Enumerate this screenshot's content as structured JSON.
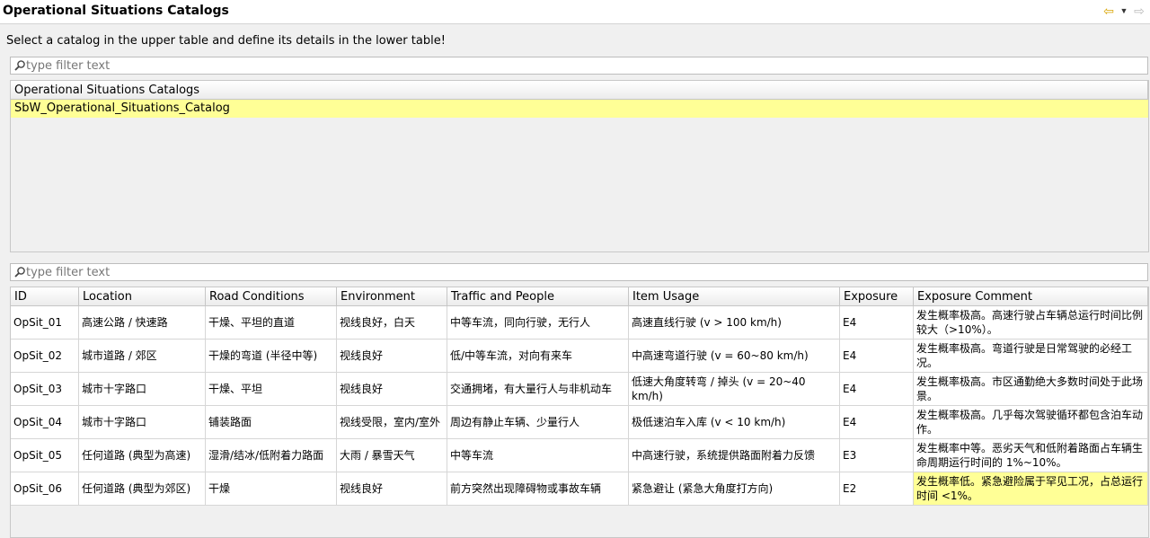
{
  "header": {
    "title": "Operational Situations Catalogs"
  },
  "instruction": "Select a catalog in the upper table and define its details in the lower table!",
  "filter_upper": {
    "placeholder": "type filter text",
    "value": ""
  },
  "filter_lower": {
    "placeholder": "type filter text",
    "value": ""
  },
  "catalog_table": {
    "header": "Operational Situations Catalogs",
    "rows": [
      "SbW_Operational_Situations_Catalog"
    ]
  },
  "detail_table": {
    "columns": [
      "ID",
      "Location",
      "Road Conditions",
      "Environment",
      "Traffic and People",
      "Item Usage",
      "Exposure",
      "Exposure Comment"
    ],
    "rows": [
      [
        "OpSit_01",
        "高速公路 / 快速路",
        "干燥、平坦的直道",
        "视线良好，白天",
        "中等车流，同向行驶，无行人",
        "高速直线行驶 (v > 100 km/h)",
        "E4",
        "发生概率极高。高速行驶占车辆总运行时间比例较大（>10%）。"
      ],
      [
        "OpSit_02",
        "城市道路 / 郊区",
        "干燥的弯道 (半径中等)",
        "视线良好",
        "低/中等车流，对向有来车",
        "中高速弯道行驶 (v = 60~80 km/h)",
        "E4",
        "发生概率极高。弯道行驶是日常驾驶的必经工况。"
      ],
      [
        "OpSit_03",
        "城市十字路口",
        "干燥、平坦",
        "视线良好",
        "交通拥堵，有大量行人与非机动车",
        "低速大角度转弯 / 掉头 (v = 20~40 km/h)",
        "E4",
        "发生概率极高。市区通勤绝大多数时间处于此场景。"
      ],
      [
        "OpSit_04",
        "城市十字路口",
        "铺装路面",
        "视线受限，室内/室外",
        "周边有静止车辆、少量行人",
        "极低速泊车入库 (v < 10 km/h)",
        "E4",
        "发生概率极高。几乎每次驾驶循环都包含泊车动作。"
      ],
      [
        "OpSit_05",
        "任何道路 (典型为高速)",
        "湿滑/结冰/低附着力路面",
        "大雨 / 暴雪天气",
        "中等车流",
        "中高速行驶，系统提供路面附着力反馈",
        "E3",
        "发生概率中等。恶劣天气和低附着路面占车辆生命周期运行时间的 1%~10%。"
      ],
      [
        "OpSit_06",
        "任何道路 (典型为郊区)",
        "干燥",
        "视线良好",
        "前方突然出现障碍物或事故车辆",
        "紧急避让 (紧急大角度打方向)",
        "E2",
        "发生概率低。紧急避险属于罕见工况，占总运行时间 <1%。"
      ]
    ]
  },
  "colors": {
    "selection": "#ffff96",
    "back_arrow": "#d9a400"
  },
  "icons": {
    "back": "arrow-left-icon",
    "menu": "dropdown-triangle-icon",
    "forward": "arrow-right-icon",
    "filter": "search-icon"
  }
}
